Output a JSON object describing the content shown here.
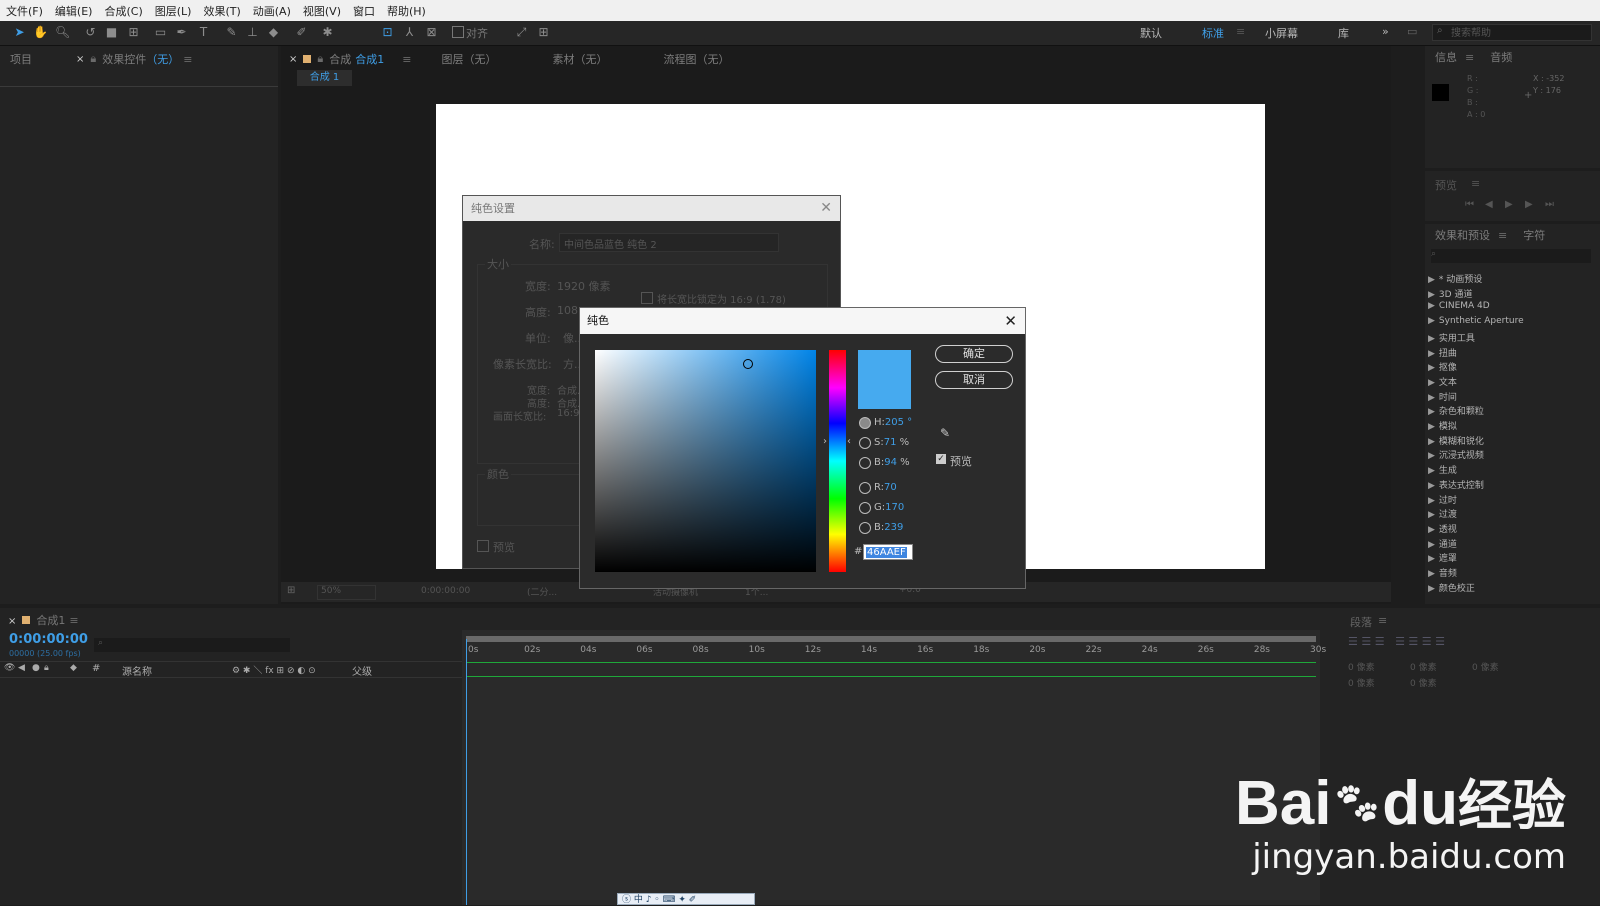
{
  "menu": [
    "文件(F)",
    "编辑(E)",
    "合成(C)",
    "图层(L)",
    "效果(T)",
    "动画(A)",
    "视图(V)",
    "窗口",
    "帮助(H)"
  ],
  "toolbar": {
    "align_label": "对齐",
    "workspaces": [
      "默认",
      "标准",
      "小屏幕",
      "库"
    ],
    "active_workspace": "标准",
    "help_placeholder": "搜索帮助"
  },
  "left_panel": {
    "tab_project": "项目",
    "tab_effects": "效果控件",
    "tab_effects_value": "（无）"
  },
  "center_panel": {
    "tab_comp": "合成",
    "tab_comp_name": "合成1",
    "tab_layer": "图层（无）",
    "tab_footage": "素材（无）",
    "tab_flow": "流程图（无）",
    "subtab": "合成 1"
  },
  "viewer_bar": {
    "zoom": "50%",
    "time": "0:00:00:00",
    "resolution": "(二分...",
    "camera": "活动摄像机",
    "views": "1个...",
    "exposure": "+0.0"
  },
  "solid_dialog": {
    "title": "纯色设置",
    "name_label": "名称:",
    "name_value": "中间色品蓝色 纯色 2",
    "size_group": "大小",
    "width_label": "宽度:",
    "width_value": "1920 像素",
    "lock_label": "将长宽比锁定为 16:9 (1.78)",
    "height_label": "高度:",
    "height_value": "108...",
    "units_label": "单位:",
    "units_value": "像...",
    "par_label": "像素长宽比:",
    "par_value": "方...",
    "info_width": "宽度:",
    "info_width_value": "合成...",
    "info_height": "高度:",
    "info_height_value": "合成...",
    "info_frame": "画面长宽比:",
    "info_frame_value": "16:9 (...",
    "color_group": "颜色",
    "preview_label": "预览"
  },
  "color_dialog": {
    "title": "纯色",
    "ok": "确定",
    "cancel": "取消",
    "preview_label": "预览",
    "h_label": "H:",
    "h_value": "205",
    "h_unit": "°",
    "s_label": "S:",
    "s_value": "71",
    "s_unit": "%",
    "b_label": "B:",
    "b_value": "94",
    "b_unit": "%",
    "r_label": "R:",
    "r_value": "70",
    "g_label": "G:",
    "g_value": "170",
    "b2_label": "B:",
    "b2_value": "239",
    "hex_prefix": "#",
    "hex_value": "46AAEF",
    "current_color": "#46AAEF"
  },
  "info_panel": {
    "tab_info": "信息",
    "tab_audio": "音频",
    "r": "R :",
    "g": "G :",
    "b": "B :",
    "a": "A : 0",
    "x": "X : -352",
    "y": "Y : 176"
  },
  "preview_panel": {
    "title": "预览"
  },
  "effects_panel": {
    "tab": "效果和预设",
    "tab2": "字符",
    "items": [
      "* 动画预设",
      "3D 通道",
      "CINEMA 4D",
      "Synthetic Aperture",
      "实用工具",
      "扭曲",
      "抠像",
      "文本",
      "时间",
      "杂色和颗粒",
      "模拟",
      "模糊和锐化",
      "沉浸式视频",
      "生成",
      "表达式控制",
      "过时",
      "过渡",
      "透视",
      "通道",
      "遮罩",
      "音频",
      "颜色校正"
    ]
  },
  "timeline": {
    "tab": "合成1",
    "timecode": "0:00:00:00",
    "fps": "00000 (25.00 fps)",
    "col_name": "源名称",
    "col_parent": "父级",
    "col_hash": "#",
    "ticks": [
      "0s",
      "02s",
      "04s",
      "06s",
      "08s",
      "10s",
      "12s",
      "14s",
      "16s",
      "18s",
      "20s",
      "22s",
      "24s",
      "26s",
      "28s",
      "30s"
    ]
  },
  "paragraph_panel": {
    "title": "段落",
    "indent1": "0 像素",
    "indent2": "0 像素",
    "indent3": "0 像素",
    "space1": "0 像素",
    "space2": "0 像素"
  },
  "watermark": {
    "brand": "Bai",
    "brand_suffix": "du",
    "product": "经验",
    "url": "jingyan.baidu.com"
  }
}
